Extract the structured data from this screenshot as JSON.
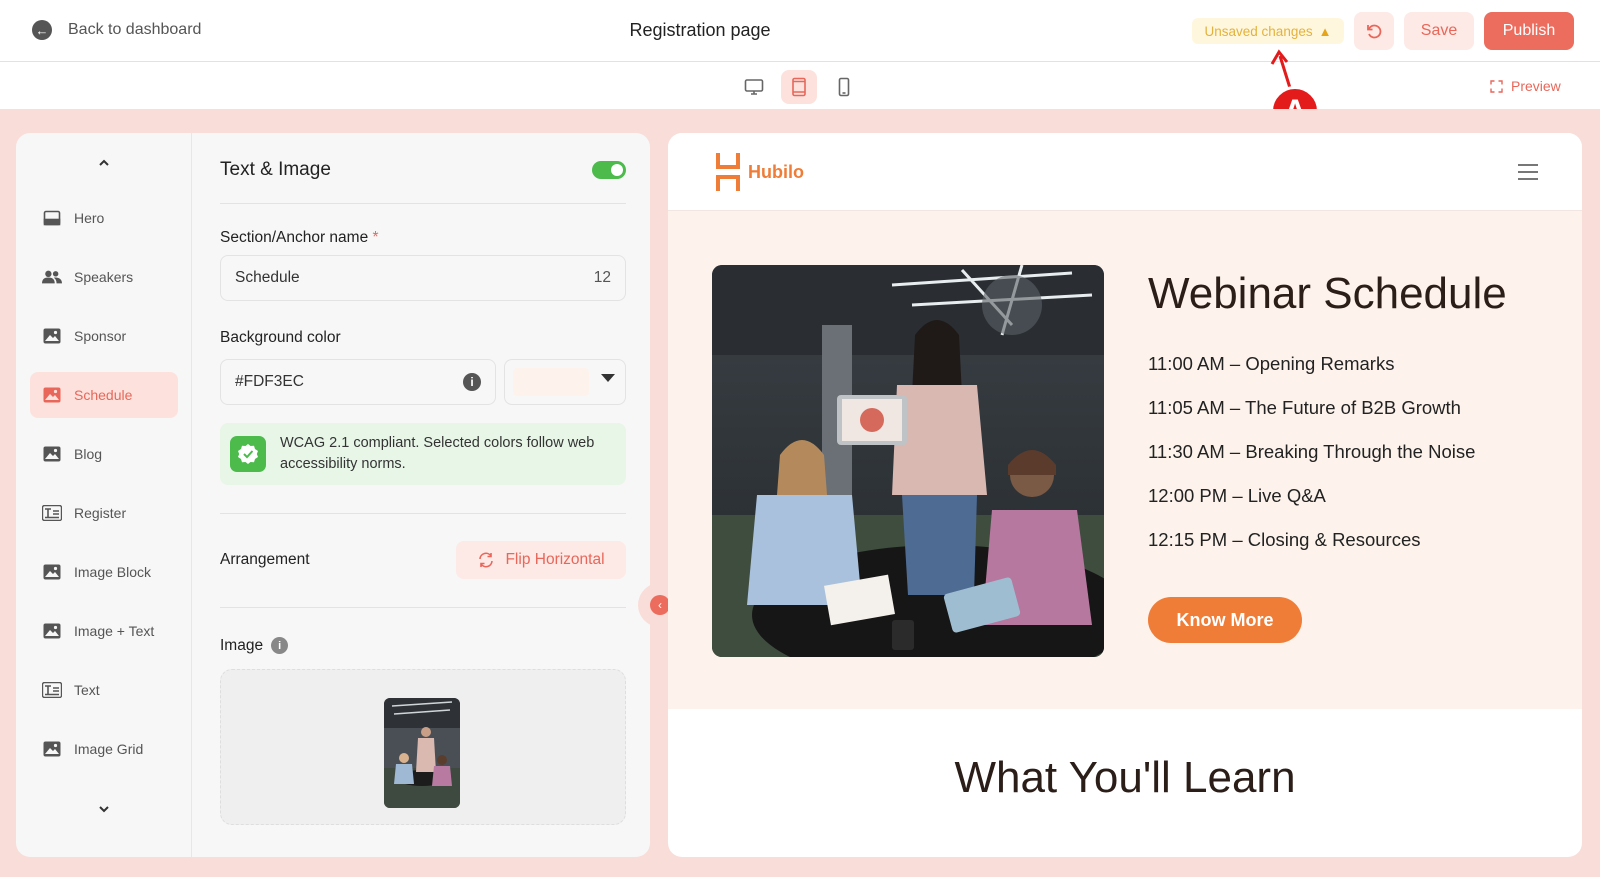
{
  "topbar": {
    "back_label": "Back to dashboard",
    "page_title": "Registration page",
    "unsaved_label": "Unsaved changes",
    "save_label": "Save",
    "publish_label": "Publish"
  },
  "devicebar": {
    "devices": [
      "desktop",
      "tablet",
      "mobile"
    ],
    "active_device": "tablet",
    "preview_label": "Preview"
  },
  "annotation": {
    "label": "A",
    "color": "#e31b1b"
  },
  "sidebar": {
    "items": [
      {
        "label": "Hero",
        "icon": "layout-icon"
      },
      {
        "label": "Speakers",
        "icon": "people-icon"
      },
      {
        "label": "Sponsor",
        "icon": "image-icon"
      },
      {
        "label": "Schedule",
        "icon": "image-icon",
        "active": true
      },
      {
        "label": "Blog",
        "icon": "image-icon"
      },
      {
        "label": "Register",
        "icon": "text-icon"
      },
      {
        "label": "Image Block",
        "icon": "image-icon"
      },
      {
        "label": "Image + Text",
        "icon": "image-icon"
      },
      {
        "label": "Text",
        "icon": "text-icon"
      },
      {
        "label": "Image Grid",
        "icon": "image-icon"
      }
    ]
  },
  "settings": {
    "section_title": "Text & Image",
    "enabled": true,
    "anchor_label": "Section/Anchor name",
    "required_mark": "*",
    "anchor_value": "Schedule",
    "anchor_count": "12",
    "bg_label": "Background color",
    "bg_value": "#FDF3EC",
    "wcag_text": "WCAG 2.1 compliant. Selected colors follow web accessibility norms.",
    "arrangement_label": "Arrangement",
    "flip_label": "Flip Horizontal",
    "image_label": "Image"
  },
  "site": {
    "logo_text": "Hubilo",
    "schedule_title": "Webinar Schedule",
    "schedule_items": [
      "11:00 AM – Opening Remarks",
      "11:05 AM – The Future of B2B Growth",
      "11:30 AM – Breaking Through the Noise",
      "12:00 PM – Live Q&A",
      "12:15 PM – Closing & Resources"
    ],
    "cta_label": "Know More",
    "next_section_title": "What You'll Learn"
  },
  "colors": {
    "accent": "#ec6c5d",
    "brand_orange": "#ef7d38",
    "section_bg": "#FDF3EC",
    "workspace_bg": "#f9ddd8",
    "success": "#4cbb4c"
  }
}
